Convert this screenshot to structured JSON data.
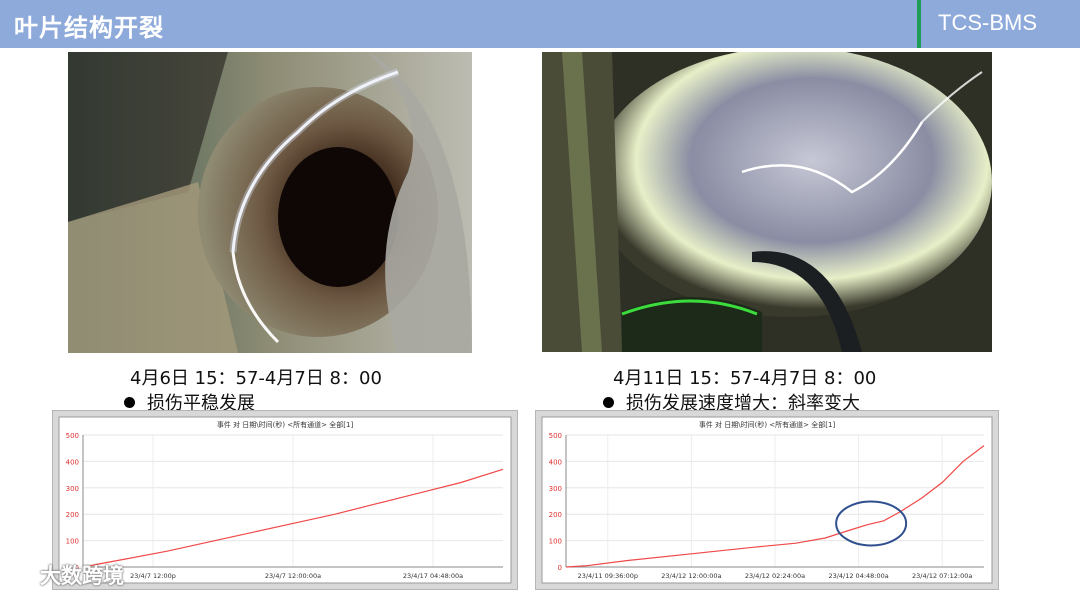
{
  "header": {
    "title": "叶片结构开裂",
    "brand": "TCS-BMS"
  },
  "left": {
    "caption": "4月6日 15：57-4月7日 8：00",
    "bullet": "损伤平稳发展",
    "chart_title": "事件 对 日期\\时间(秒) <所有通道> 全部[1]"
  },
  "right": {
    "caption": "4月11日 15：57-4月7日 8：00",
    "bullet": "损伤发展速度增大：斜率变大",
    "chart_title": "事件 对 日期\\时间(秒) <所有通道> 全部[1]"
  },
  "watermark": "大数跨境",
  "chart_data": [
    {
      "type": "line",
      "title": "事件 对 日期\\时间(秒) <所有通道> 全部[1]",
      "xlabel": "",
      "ylabel": "",
      "ylim": [
        0,
        500
      ],
      "yticks": [
        "0",
        "100",
        "200",
        "300",
        "400",
        "500"
      ],
      "xticks": [
        "23/4/7 12:00p",
        "23/4/7 12:00:00a",
        "23/4/17 04:48:00a"
      ],
      "series": [
        {
          "values": [
            [
              0,
              0
            ],
            [
              0.05,
              15
            ],
            [
              0.1,
              30
            ],
            [
              0.2,
              60
            ],
            [
              0.3,
              95
            ],
            [
              0.4,
              130
            ],
            [
              0.5,
              165
            ],
            [
              0.6,
              200
            ],
            [
              0.7,
              240
            ],
            [
              0.8,
              280
            ],
            [
              0.9,
              320
            ],
            [
              1.0,
              370
            ]
          ]
        }
      ],
      "grid": true,
      "color": "#f04848"
    },
    {
      "type": "line",
      "title": "事件 对 日期\\时间(秒) <所有通道> 全部[1]",
      "xlabel": "",
      "ylabel": "",
      "ylim": [
        0,
        500
      ],
      "yticks": [
        "0",
        "100",
        "200",
        "300",
        "400",
        "500"
      ],
      "xticks": [
        "23/4/11 09:36:00p",
        "23/4/12 12:00:00a",
        "23/4/12 02:24:00a",
        "23/4/12 04:48:00a",
        "23/4/12 07:12:00a"
      ],
      "series": [
        {
          "values": [
            [
              0,
              0
            ],
            [
              0.05,
              5
            ],
            [
              0.15,
              25
            ],
            [
              0.3,
              50
            ],
            [
              0.45,
              75
            ],
            [
              0.55,
              90
            ],
            [
              0.62,
              110
            ],
            [
              0.68,
              140
            ],
            [
              0.72,
              160
            ],
            [
              0.76,
              175
            ],
            [
              0.8,
              210
            ],
            [
              0.85,
              260
            ],
            [
              0.9,
              320
            ],
            [
              0.95,
              400
            ],
            [
              1.0,
              460
            ]
          ]
        }
      ],
      "grid": true,
      "color": "#f04848",
      "annotation": "ellipse marking slope increase"
    }
  ]
}
